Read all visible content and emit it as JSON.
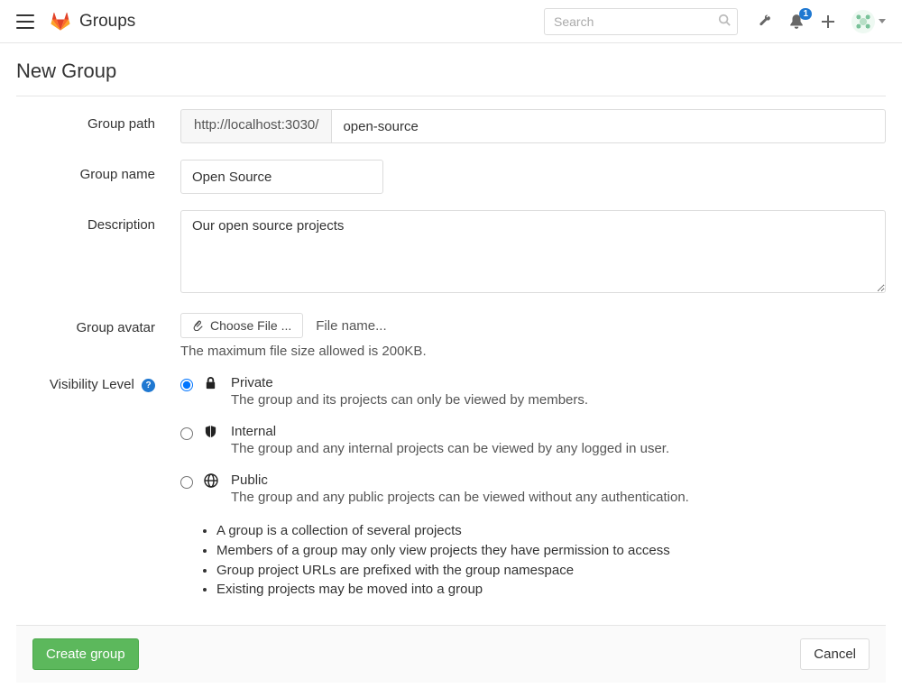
{
  "header": {
    "brand": "Groups",
    "search_placeholder": "Search",
    "notification_count": "1"
  },
  "page": {
    "title": "New Group"
  },
  "form": {
    "group_path": {
      "label": "Group path",
      "prefix": "http://localhost:3030/",
      "value": "open-source"
    },
    "group_name": {
      "label": "Group name",
      "value": "Open Source"
    },
    "description": {
      "label": "Description",
      "value": "Our open source projects"
    },
    "group_avatar": {
      "label": "Group avatar",
      "button": "Choose File ...",
      "filename": "File name...",
      "help": "The maximum file size allowed is 200KB."
    },
    "visibility": {
      "label": "Visibility Level",
      "selected": "private",
      "options": [
        {
          "key": "private",
          "title": "Private",
          "desc": "The group and its projects can only be viewed by members.",
          "icon": "lock-icon"
        },
        {
          "key": "internal",
          "title": "Internal",
          "desc": "The group and any internal projects can be viewed by any logged in user.",
          "icon": "shield-icon"
        },
        {
          "key": "public",
          "title": "Public",
          "desc": "The group and any public projects can be viewed without any authentication.",
          "icon": "globe-icon"
        }
      ]
    },
    "info": [
      "A group is a collection of several projects",
      "Members of a group may only view projects they have permission to access",
      "Group project URLs are prefixed with the group namespace",
      "Existing projects may be moved into a group"
    ]
  },
  "footer": {
    "submit": "Create group",
    "cancel": "Cancel"
  }
}
